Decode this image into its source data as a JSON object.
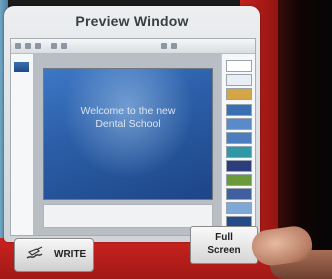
{
  "preview": {
    "title": "Preview Window",
    "slide_title_line1": "Welcome to the new",
    "slide_title_line2": "Dental School"
  },
  "buttons": {
    "write_label": "WRITE",
    "fullscreen_line1": "Full",
    "fullscreen_line2": "Screen"
  },
  "icons": {
    "write": "hand-pen-icon"
  },
  "colors": {
    "kiosk_red": "#c4201d",
    "slide_blue": "#2c5fa8",
    "panel_gray": "#e3e6e9"
  }
}
